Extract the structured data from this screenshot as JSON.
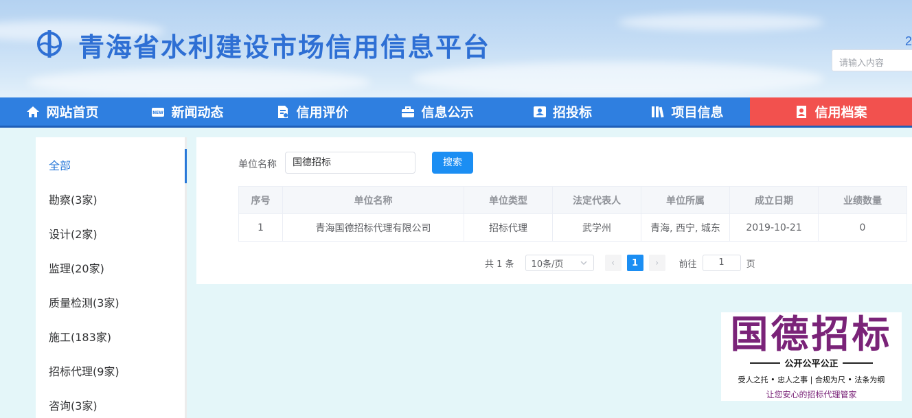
{
  "header": {
    "title": "青海省水利建设市场信用信息平台",
    "corner_digit": "2",
    "search_placeholder": "请输入内容"
  },
  "nav": [
    {
      "label": "网站首页",
      "icon": "home-icon"
    },
    {
      "label": "新闻动态",
      "icon": "news-icon"
    },
    {
      "label": "信用评价",
      "icon": "evaluation-icon"
    },
    {
      "label": "信息公示",
      "icon": "briefcase-icon"
    },
    {
      "label": "招投标",
      "icon": "contact-card-icon"
    },
    {
      "label": "项目信息",
      "icon": "books-icon"
    },
    {
      "label": "信用档案",
      "icon": "archive-user-icon",
      "active": true
    }
  ],
  "sidebar": {
    "items": [
      {
        "label": "全部",
        "active": true
      },
      {
        "label": "勘察(3家)"
      },
      {
        "label": "设计(2家)"
      },
      {
        "label": "监理(20家)"
      },
      {
        "label": "质量检测(3家)"
      },
      {
        "label": "施工(183家)"
      },
      {
        "label": "招标代理(9家)"
      },
      {
        "label": "咨询(3家)"
      }
    ]
  },
  "filter": {
    "label": "单位名称",
    "value": "国德招标",
    "button": "搜索"
  },
  "table": {
    "headers": [
      "序号",
      "单位名称",
      "单位类型",
      "法定代表人",
      "单位所属",
      "成立日期",
      "业绩数量"
    ],
    "rows": [
      [
        "1",
        "青海国德招标代理有限公司",
        "招标代理",
        "武学州",
        "青海, 西宁, 城东",
        "2019-10-21",
        "0"
      ]
    ]
  },
  "pagination": {
    "total": "共 1 条",
    "page_size": "10条/页",
    "prev": "‹",
    "current": "1",
    "next": "›",
    "goto_label": "前往",
    "goto_value": "1",
    "page_unit": "页"
  },
  "watermark": {
    "title": "国德招标",
    "slogan": "公开公平公正",
    "motto": "受人之托 • 忠人之事 | 合规为尺 • 法条为纲",
    "tagline": "让您安心的招标代理管家"
  },
  "colors": {
    "nav_bg": "#2f7fe0",
    "nav_active": "#f2514e",
    "title": "#2e6fd4",
    "primary_button": "#1b8ef3",
    "watermark": "#7a2378"
  }
}
